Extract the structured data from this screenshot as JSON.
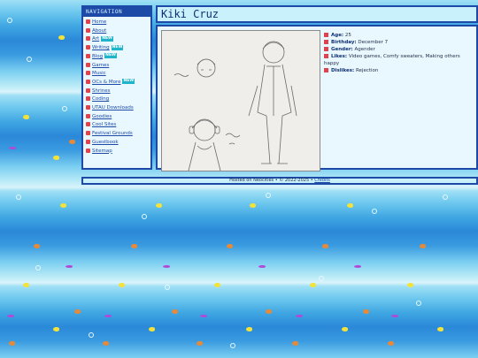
{
  "nav": {
    "header": "NAVIGATION",
    "items": [
      {
        "label": "Home",
        "badge": ""
      },
      {
        "label": "About",
        "badge": ""
      },
      {
        "label": "Art",
        "badge": "NEW"
      },
      {
        "label": "Writing",
        "badge": "NEW"
      },
      {
        "label": "Blog",
        "badge": "NEW"
      },
      {
        "label": "Games",
        "badge": ""
      },
      {
        "label": "Music",
        "badge": ""
      },
      {
        "label": "OCs & More",
        "badge": "NEW"
      },
      {
        "label": "Shrines",
        "badge": ""
      },
      {
        "label": "Coding",
        "badge": ""
      },
      {
        "label": "UTAU Downloads",
        "badge": ""
      },
      {
        "label": "Goodies",
        "badge": ""
      },
      {
        "label": "Cool Sites",
        "badge": ""
      },
      {
        "label": "Festival Grounds",
        "badge": ""
      },
      {
        "label": "Guestbook",
        "badge": ""
      },
      {
        "label": "Sitemap",
        "badge": ""
      }
    ]
  },
  "page": {
    "title": "Kiki Cruz"
  },
  "facts": [
    {
      "label": "Age:",
      "value": "25"
    },
    {
      "label": "Birthday:",
      "value": "December 7"
    },
    {
      "label": "Gender:",
      "value": "Agender"
    },
    {
      "label": "Likes:",
      "value": "Video games, Comfy sweaters, Making others happy"
    },
    {
      "label": "Dislikes:",
      "value": "Rejection"
    }
  ],
  "footer": {
    "text": "Hosted on Neocities • © 2022-2025 •",
    "link": "Credits"
  },
  "colors": {
    "border": "#1d4aa6",
    "panel": "#e9f8ff",
    "title_bg": "#c9f1fb",
    "accent": "#e0434d",
    "badge": "#21b3c9"
  }
}
